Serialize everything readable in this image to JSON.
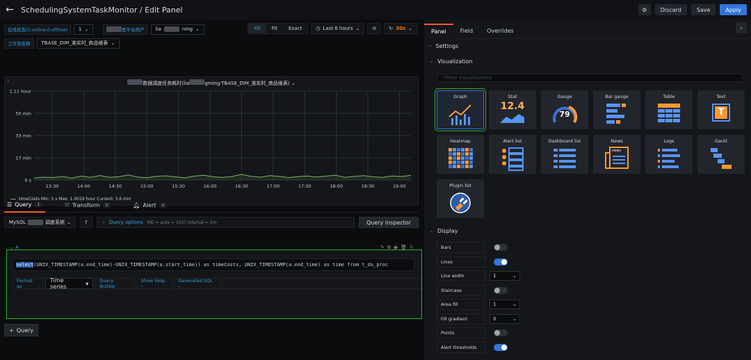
{
  "header": {
    "title": "SchedulingSystemTaskMonitor / Edit Panel",
    "discard": "Discard",
    "save": "Save",
    "apply": "Apply"
  },
  "variables": {
    "status_label": "在线状态(1:online,0:offline)",
    "status_value": "1",
    "user_label": "度平台用户",
    "user_prefix": "lia",
    "user_suffix": "ning",
    "workflow_label": "工作流名称",
    "workflow_value": "TBASE_DIM_准实时_商品维表"
  },
  "time_controls": {
    "fill": "Fill",
    "fit": "Fit",
    "exact": "Exact",
    "range": "Last 6 hours",
    "refresh": "30s"
  },
  "panel": {
    "title_prefix": "数据调度任务耗时(lia",
    "title_suffix": "gming-TBASE_DIM_准实时_商品维表)",
    "legend": "timeCosts  Min: 5 s  Max: 1.0019 hour  Current: 3.6 min"
  },
  "chart_data": {
    "type": "line",
    "y_ticks": [
      "1.11 hour",
      "50 min",
      "33 min",
      "17 min",
      "0 s"
    ],
    "x_ticks": [
      "13:30",
      "14:00",
      "14:30",
      "15:00",
      "15:30",
      "16:00",
      "16:30",
      "17:00",
      "17:30",
      "18:00",
      "18:30",
      "19:00"
    ],
    "ylim_minutes": [
      0,
      66.6
    ],
    "series": [
      {
        "name": "timeCosts",
        "color": "#7eb26d",
        "values_minutes": [
          1.5,
          2.1,
          1.8,
          2.6,
          1.4,
          2.9,
          2.0,
          3.4,
          1.9,
          2.5,
          3.8,
          2.2,
          1.7,
          2.8,
          3.1,
          2.3,
          1.6,
          2.9,
          3.6,
          2.4,
          1.9,
          2.6,
          4.2,
          2.8,
          2.1,
          3.3,
          2.7,
          1.8,
          2.5,
          3.0,
          2.2,
          2.9,
          3.6,
          2.0,
          2.7,
          3.2,
          2.4,
          1.9,
          3.0,
          2.6,
          3.6
        ]
      }
    ]
  },
  "query_tabs": [
    {
      "label": "Query",
      "count": "1"
    },
    {
      "label": "Transform",
      "count": "0"
    },
    {
      "label": "Alert",
      "count": "0"
    }
  ],
  "datasource": {
    "name_prefix": "MySQL",
    "name_suffix": "调度系统",
    "query_options": "Query options",
    "meta": "MD = auto = 1037    Interval = 1m",
    "inspector": "Query inspector"
  },
  "query": {
    "ref": "A",
    "sql_highlight": "select",
    "sql": " (UNIX_TIMESTAMP(a.end_time)-UNIX_TIMESTAMP(a.start_time)) as timeCosts, UNIX_TIMESTAMP(a.end_time) as time    from t_ds_proc",
    "format_as": "Format as",
    "format_value": "Time series",
    "query_builder": "Query Builder",
    "show_help": "Show Help ›",
    "generated_sql": "Generated SQL ›",
    "add_query": "Query"
  },
  "right_tabs": [
    "Panel",
    "Field",
    "Overrides"
  ],
  "sections": {
    "settings": "Settings",
    "visualization": "Visualization",
    "filter_placeholder": "Filter visualizations",
    "display": "Display"
  },
  "visualizations": [
    {
      "name": "Graph",
      "icon": "graph-icon"
    },
    {
      "name": "Stat",
      "icon": "stat-icon",
      "value": "12.4"
    },
    {
      "name": "Gauge",
      "icon": "gauge-icon",
      "value": "79"
    },
    {
      "name": "Bar gauge",
      "icon": "bar-gauge-icon"
    },
    {
      "name": "Table",
      "icon": "table-icon"
    },
    {
      "name": "Text",
      "icon": "text-icon",
      "value": "T"
    },
    {
      "name": "Heatmap",
      "icon": "heatmap-icon"
    },
    {
      "name": "Alert list",
      "icon": "alert-list-icon"
    },
    {
      "name": "Dashboard list",
      "icon": "dashboard-list-icon"
    },
    {
      "name": "News",
      "icon": "news-icon",
      "value": "news"
    },
    {
      "name": "Logs",
      "icon": "logs-icon"
    },
    {
      "name": "Gantt",
      "icon": "gantt-icon"
    },
    {
      "name": "Plugin list",
      "icon": "plugin-list-icon"
    }
  ],
  "display_options": [
    {
      "label": "Bars",
      "kind": "switch",
      "on": false
    },
    {
      "label": "Lines",
      "kind": "switch",
      "on": true
    },
    {
      "label": "Line width",
      "kind": "select",
      "value": "1"
    },
    {
      "label": "Staircase",
      "kind": "switch",
      "on": false
    },
    {
      "label": "Area fill",
      "kind": "select",
      "value": "1"
    },
    {
      "label": "Fill gradient",
      "kind": "select",
      "value": "0"
    },
    {
      "label": "Points",
      "kind": "switch",
      "on": false
    },
    {
      "label": "Alert thresholds",
      "kind": "switch",
      "on": true
    }
  ]
}
